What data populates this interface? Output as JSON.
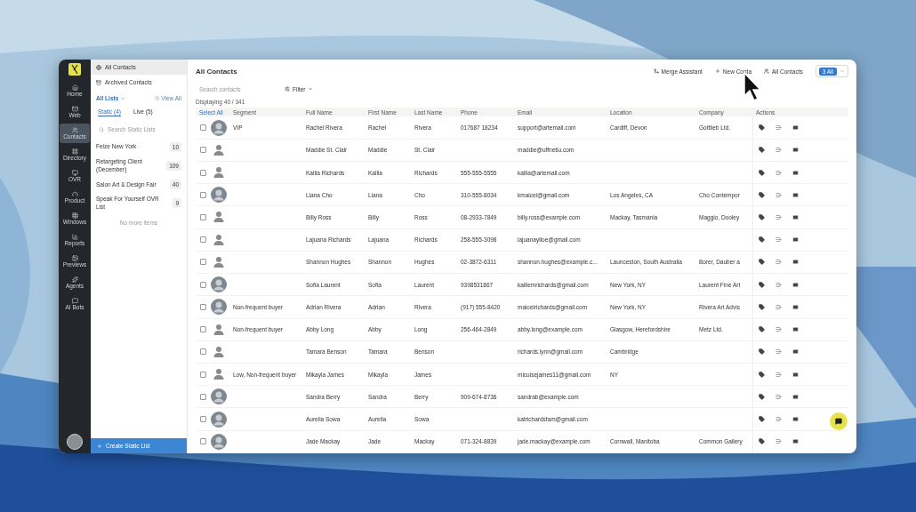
{
  "rail": {
    "items": [
      {
        "label": "Home",
        "selected": false
      },
      {
        "label": "Web",
        "selected": false
      },
      {
        "label": "Contacts",
        "selected": true
      },
      {
        "label": "Directory",
        "selected": false
      },
      {
        "label": "OVR",
        "selected": false
      },
      {
        "label": "Product",
        "selected": false
      },
      {
        "label": "Windows",
        "selected": false
      },
      {
        "label": "Reports",
        "selected": false
      },
      {
        "label": "Previews",
        "selected": false
      },
      {
        "label": "Agents",
        "selected": false
      },
      {
        "label": "AI Bots",
        "selected": false
      }
    ]
  },
  "lists_panel": {
    "nav": [
      {
        "label": "All Contacts",
        "selected": true
      },
      {
        "label": "Archived Contacts",
        "selected": false
      }
    ],
    "heading": "All Lists",
    "view_all": "View All",
    "tabs": [
      {
        "label": "Static (4)",
        "selected": true
      },
      {
        "label": "Live (5)",
        "selected": false
      }
    ],
    "search": {
      "placeholder": "Search Static Lists"
    },
    "lists": [
      {
        "name": "Feize New York",
        "count": "10"
      },
      {
        "name": "Retargeting Client (December)",
        "count": "109"
      },
      {
        "name": "Salon Art & Design Fair",
        "count": "40"
      },
      {
        "name": "Speak For Yourself OVR List",
        "count": "9"
      }
    ],
    "end_note": "No more items",
    "create_button": "Create Static List"
  },
  "main": {
    "title": "All Contacts",
    "toolbar": [
      "Merge Assistant",
      "New Conta",
      "All Contacts"
    ],
    "view_button": "3 All",
    "search": {
      "placeholder": "Search contacts"
    },
    "filter": "Filter",
    "count": "Displaying 40 / 341",
    "table": {
      "select_all": "Select All",
      "columns": [
        "Segment",
        "Full Name",
        "First Name",
        "Last Name",
        "Phone",
        "Email",
        "Location",
        "Company",
        "Actions"
      ],
      "rows": [
        {
          "checked": false,
          "cells": [
            "VIP",
            "Rachel Rivera",
            "Rachel",
            "Rivera",
            "017687 18234",
            "support@artemail.com",
            "Cardiff, Devon",
            "Gottlieb Ltd."
          ]
        },
        {
          "checked": false,
          "kind": "placeholder",
          "cells": [
            "",
            "Maddie St. Clair",
            "Maddie",
            "St. Clair",
            "",
            "maddie@uffnetiu.com",
            "",
            ""
          ]
        },
        {
          "checked": false,
          "kind": "placeholder",
          "cells": [
            "",
            "Kallia Richards",
            "Kallia",
            "Richards",
            "555-555-5555",
            "kallia@artemail.com",
            "",
            ""
          ]
        },
        {
          "checked": false,
          "cells": [
            "",
            "Liana Cho",
            "Liana",
            "Cho",
            "310-555-8034",
            "kmaicel@gmail.com",
            "Los Angeles, CA",
            "Cho Contempor"
          ]
        },
        {
          "checked": false,
          "kind": "placeholder",
          "cells": [
            "",
            "Billy Ross",
            "Billy",
            "Ross",
            "08-2933-7849",
            "billy.ross@example.com",
            "Mackay, Tasmania",
            "Maggio, Dooley"
          ]
        },
        {
          "checked": false,
          "kind": "placeholder",
          "cells": [
            "",
            "Lajuana Richards",
            "Lajuana",
            "Richards",
            "258-555-3098",
            "lajuanaylloe@gmail.com",
            "",
            ""
          ]
        },
        {
          "checked": false,
          "kind": "placeholder",
          "cells": [
            "",
            "Shannon Hughes",
            "Shannon",
            "Hughes",
            "02-3872-6311",
            "shannon.hughes@example.c...",
            "Launceston, South Australia",
            "Borer, Dauber a"
          ]
        },
        {
          "checked": false,
          "cells": [
            "",
            "Sofia Laurent",
            "Sofia",
            "Laurent",
            "9398531867",
            "kailiemrichards@gmail.com",
            "New York, NY",
            "Laurent Fine Art"
          ]
        },
        {
          "checked": false,
          "cells": [
            "Non-frequent buyer",
            "Adrian Rivera",
            "Adrian",
            "Rivera",
            "(917) 555-8420",
            "maicelrichards@gmail.com",
            "New York, NY",
            "Rivera Art Advis"
          ]
        },
        {
          "checked": false,
          "kind": "placeholder",
          "cells": [
            "Non-frequent buyer",
            "Abby Long",
            "Abby",
            "Long",
            "256-464-2849",
            "abby.long@example.com",
            "Glasgow, Herefordshire",
            "Metz Ltd."
          ]
        },
        {
          "checked": false,
          "kind": "placeholder",
          "cells": [
            "",
            "Tamara Benson",
            "Tamara",
            "Benson",
            "",
            "richards.lynn@gmail.com",
            "Cambridge",
            ""
          ]
        },
        {
          "checked": false,
          "kind": "placeholder",
          "cells": [
            "Low, Non-frequent buyer",
            "Mikayla James",
            "Mikayla",
            "James",
            "",
            "micuisejames11@gmail.com",
            "NY",
            ""
          ]
        },
        {
          "checked": false,
          "cells": [
            "",
            "Sandra Berry",
            "Sandra",
            "Berry",
            "909-674-8736",
            "sandrab@example.com",
            "",
            ""
          ]
        },
        {
          "checked": false,
          "cells": [
            "",
            "Aurelia Sowa",
            "Aurelia",
            "Sowa",
            "",
            "katrichardsfam@gmail.com",
            "",
            ""
          ]
        },
        {
          "checked": false,
          "cells": [
            "",
            "Jade Mackay",
            "Jade",
            "Mackay",
            "071-324-8839",
            "jade.mackay@example.com",
            "Cornwall, Manitoba",
            "Common Gallery"
          ]
        }
      ]
    }
  }
}
